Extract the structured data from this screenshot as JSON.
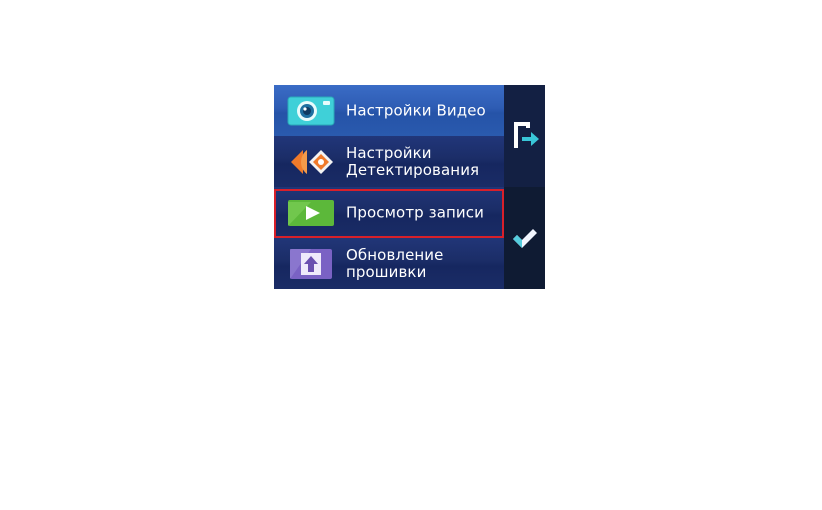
{
  "menu": {
    "items": [
      {
        "label": "Настройки Видео",
        "icon": "camera-icon",
        "selected": false
      },
      {
        "label": "Настройки\nДетектирования",
        "icon": "radar-detector-icon",
        "selected": false
      },
      {
        "label": "Просмотр записи",
        "icon": "play-icon",
        "selected": true
      },
      {
        "label": "Обновление\nпрошивки",
        "icon": "upload-arrow-icon",
        "selected": false
      }
    ]
  },
  "side": {
    "exit_icon": "exit-icon",
    "ok_icon": "checkmark-icon"
  },
  "colors": {
    "panel": "#1b2c5e",
    "highlight_row": "#2e5cb3",
    "selection_frame": "#d8202a",
    "accent_cyan": "#39c6d8",
    "play_green": "#5cb83a",
    "upload_purple": "#6a4fb0",
    "detector_orange": "#f07a2a"
  }
}
